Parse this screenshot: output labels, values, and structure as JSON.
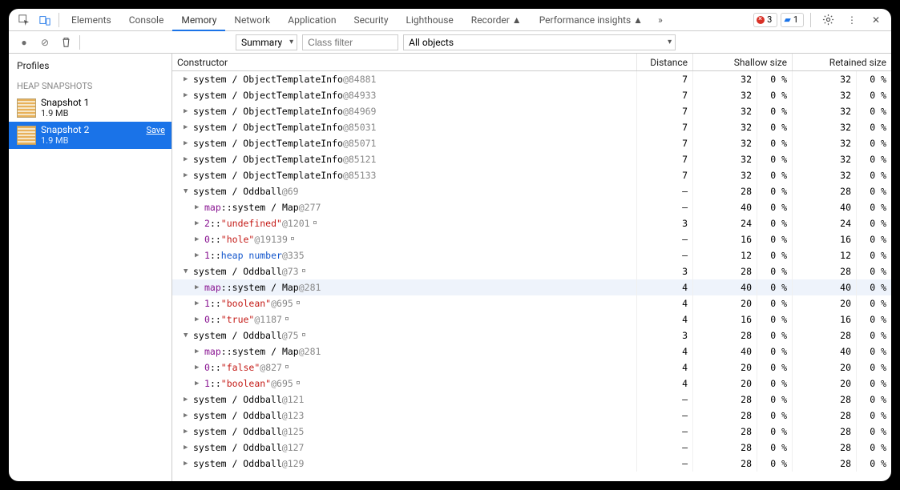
{
  "tabs": {
    "items": [
      "Elements",
      "Console",
      "Memory",
      "Network",
      "Application",
      "Security",
      "Lighthouse",
      "Recorder ▲",
      "Performance insights ▲"
    ],
    "active": 2
  },
  "status": {
    "errors": "3",
    "messages": "1"
  },
  "toolbar": {
    "viewLabel": "Summary",
    "filterPlaceholder": "Class filter",
    "scopeLabel": "All objects"
  },
  "sidebar": {
    "title": "Profiles",
    "section": "HEAP SNAPSHOTS",
    "items": [
      {
        "name": "Snapshot 1",
        "size": "1.9 MB",
        "selected": false
      },
      {
        "name": "Snapshot 2",
        "size": "1.9 MB",
        "selected": true,
        "save": "Save"
      }
    ]
  },
  "columns": {
    "constructor": "Constructor",
    "distance": "Distance",
    "shallow": "Shallow size",
    "retained": "Retained size"
  },
  "rows": [
    {
      "depth": 0,
      "exp": "c",
      "parts": [
        {
          "t": "system / ObjectTemplateInfo "
        },
        {
          "t": "@84881",
          "c": "k-addr"
        }
      ],
      "d": "7",
      "s": "32",
      "sp": "0 %",
      "r": "32",
      "rp": "0 %"
    },
    {
      "depth": 0,
      "exp": "c",
      "parts": [
        {
          "t": "system / ObjectTemplateInfo "
        },
        {
          "t": "@84933",
          "c": "k-addr"
        }
      ],
      "d": "7",
      "s": "32",
      "sp": "0 %",
      "r": "32",
      "rp": "0 %"
    },
    {
      "depth": 0,
      "exp": "c",
      "parts": [
        {
          "t": "system / ObjectTemplateInfo "
        },
        {
          "t": "@84969",
          "c": "k-addr"
        }
      ],
      "d": "7",
      "s": "32",
      "sp": "0 %",
      "r": "32",
      "rp": "0 %"
    },
    {
      "depth": 0,
      "exp": "c",
      "parts": [
        {
          "t": "system / ObjectTemplateInfo "
        },
        {
          "t": "@85031",
          "c": "k-addr"
        }
      ],
      "d": "7",
      "s": "32",
      "sp": "0 %",
      "r": "32",
      "rp": "0 %"
    },
    {
      "depth": 0,
      "exp": "c",
      "parts": [
        {
          "t": "system / ObjectTemplateInfo "
        },
        {
          "t": "@85071",
          "c": "k-addr"
        }
      ],
      "d": "7",
      "s": "32",
      "sp": "0 %",
      "r": "32",
      "rp": "0 %"
    },
    {
      "depth": 0,
      "exp": "c",
      "parts": [
        {
          "t": "system / ObjectTemplateInfo "
        },
        {
          "t": "@85121",
          "c": "k-addr"
        }
      ],
      "d": "7",
      "s": "32",
      "sp": "0 %",
      "r": "32",
      "rp": "0 %"
    },
    {
      "depth": 0,
      "exp": "c",
      "parts": [
        {
          "t": "system / ObjectTemplateInfo "
        },
        {
          "t": "@85133",
          "c": "k-addr"
        }
      ],
      "d": "7",
      "s": "32",
      "sp": "0 %",
      "r": "32",
      "rp": "0 %"
    },
    {
      "depth": 0,
      "exp": "o",
      "parts": [
        {
          "t": "system / Oddball "
        },
        {
          "t": "@69",
          "c": "k-addr"
        }
      ],
      "d": "–",
      "s": "28",
      "sp": "0 %",
      "r": "28",
      "rp": "0 %"
    },
    {
      "depth": 1,
      "exp": "c",
      "parts": [
        {
          "t": "map",
          "c": "k-prop"
        },
        {
          "t": " :: "
        },
        {
          "t": "system / Map "
        },
        {
          "t": "@277",
          "c": "k-addr"
        }
      ],
      "d": "–",
      "s": "40",
      "sp": "0 %",
      "r": "40",
      "rp": "0 %"
    },
    {
      "depth": 1,
      "exp": "c",
      "parts": [
        {
          "t": "2",
          "c": "k-prop"
        },
        {
          "t": " :: "
        },
        {
          "t": "\"undefined\"",
          "c": "k-red"
        },
        {
          "t": " @1201",
          "c": "k-addr"
        }
      ],
      "link": true,
      "d": "3",
      "s": "24",
      "sp": "0 %",
      "r": "24",
      "rp": "0 %"
    },
    {
      "depth": 1,
      "exp": "c",
      "parts": [
        {
          "t": "0",
          "c": "k-prop"
        },
        {
          "t": " :: "
        },
        {
          "t": "\"hole\"",
          "c": "k-red"
        },
        {
          "t": " @19139",
          "c": "k-addr"
        }
      ],
      "link": true,
      "d": "–",
      "s": "16",
      "sp": "0 %",
      "r": "16",
      "rp": "0 %"
    },
    {
      "depth": 1,
      "exp": "c",
      "parts": [
        {
          "t": "1",
          "c": "k-prop"
        },
        {
          "t": " :: "
        },
        {
          "t": "heap number",
          "c": "k-blue"
        },
        {
          "t": " @335",
          "c": "k-addr"
        }
      ],
      "d": "–",
      "s": "12",
      "sp": "0 %",
      "r": "12",
      "rp": "0 %"
    },
    {
      "depth": 0,
      "exp": "o",
      "parts": [
        {
          "t": "system / Oddball "
        },
        {
          "t": "@73",
          "c": "k-addr"
        }
      ],
      "link": true,
      "d": "3",
      "s": "28",
      "sp": "0 %",
      "r": "28",
      "rp": "0 %"
    },
    {
      "depth": 1,
      "exp": "c",
      "hover": true,
      "parts": [
        {
          "t": "map",
          "c": "k-prop"
        },
        {
          "t": " :: "
        },
        {
          "t": "system / Map "
        },
        {
          "t": "@281",
          "c": "k-addr"
        }
      ],
      "d": "4",
      "s": "40",
      "sp": "0 %",
      "r": "40",
      "rp": "0 %"
    },
    {
      "depth": 1,
      "exp": "c",
      "parts": [
        {
          "t": "1",
          "c": "k-prop"
        },
        {
          "t": " :: "
        },
        {
          "t": "\"boolean\"",
          "c": "k-red"
        },
        {
          "t": " @695",
          "c": "k-addr"
        }
      ],
      "link": true,
      "d": "4",
      "s": "20",
      "sp": "0 %",
      "r": "20",
      "rp": "0 %"
    },
    {
      "depth": 1,
      "exp": "c",
      "parts": [
        {
          "t": "0",
          "c": "k-prop"
        },
        {
          "t": " :: "
        },
        {
          "t": "\"true\"",
          "c": "k-red"
        },
        {
          "t": " @1187",
          "c": "k-addr"
        }
      ],
      "link": true,
      "d": "4",
      "s": "16",
      "sp": "0 %",
      "r": "16",
      "rp": "0 %"
    },
    {
      "depth": 0,
      "exp": "o",
      "parts": [
        {
          "t": "system / Oddball "
        },
        {
          "t": "@75",
          "c": "k-addr"
        }
      ],
      "link": true,
      "d": "3",
      "s": "28",
      "sp": "0 %",
      "r": "28",
      "rp": "0 %"
    },
    {
      "depth": 1,
      "exp": "c",
      "parts": [
        {
          "t": "map",
          "c": "k-prop"
        },
        {
          "t": " :: "
        },
        {
          "t": "system / Map "
        },
        {
          "t": "@281",
          "c": "k-addr"
        }
      ],
      "d": "4",
      "s": "40",
      "sp": "0 %",
      "r": "40",
      "rp": "0 %"
    },
    {
      "depth": 1,
      "exp": "c",
      "parts": [
        {
          "t": "0",
          "c": "k-prop"
        },
        {
          "t": " :: "
        },
        {
          "t": "\"false\"",
          "c": "k-red"
        },
        {
          "t": " @827",
          "c": "k-addr"
        }
      ],
      "link": true,
      "d": "4",
      "s": "20",
      "sp": "0 %",
      "r": "20",
      "rp": "0 %"
    },
    {
      "depth": 1,
      "exp": "c",
      "parts": [
        {
          "t": "1",
          "c": "k-prop"
        },
        {
          "t": " :: "
        },
        {
          "t": "\"boolean\"",
          "c": "k-red"
        },
        {
          "t": " @695",
          "c": "k-addr"
        }
      ],
      "link": true,
      "d": "4",
      "s": "20",
      "sp": "0 %",
      "r": "20",
      "rp": "0 %"
    },
    {
      "depth": 0,
      "exp": "c",
      "parts": [
        {
          "t": "system / Oddball "
        },
        {
          "t": "@121",
          "c": "k-addr"
        }
      ],
      "d": "–",
      "s": "28",
      "sp": "0 %",
      "r": "28",
      "rp": "0 %"
    },
    {
      "depth": 0,
      "exp": "c",
      "parts": [
        {
          "t": "system / Oddball "
        },
        {
          "t": "@123",
          "c": "k-addr"
        }
      ],
      "d": "–",
      "s": "28",
      "sp": "0 %",
      "r": "28",
      "rp": "0 %"
    },
    {
      "depth": 0,
      "exp": "c",
      "parts": [
        {
          "t": "system / Oddball "
        },
        {
          "t": "@125",
          "c": "k-addr"
        }
      ],
      "d": "–",
      "s": "28",
      "sp": "0 %",
      "r": "28",
      "rp": "0 %"
    },
    {
      "depth": 0,
      "exp": "c",
      "parts": [
        {
          "t": "system / Oddball "
        },
        {
          "t": "@127",
          "c": "k-addr"
        }
      ],
      "d": "–",
      "s": "28",
      "sp": "0 %",
      "r": "28",
      "rp": "0 %"
    },
    {
      "depth": 0,
      "exp": "c",
      "parts": [
        {
          "t": "system / Oddball "
        },
        {
          "t": "@129",
          "c": "k-addr"
        }
      ],
      "d": "–",
      "s": "28",
      "sp": "0 %",
      "r": "28",
      "rp": "0 %"
    }
  ]
}
